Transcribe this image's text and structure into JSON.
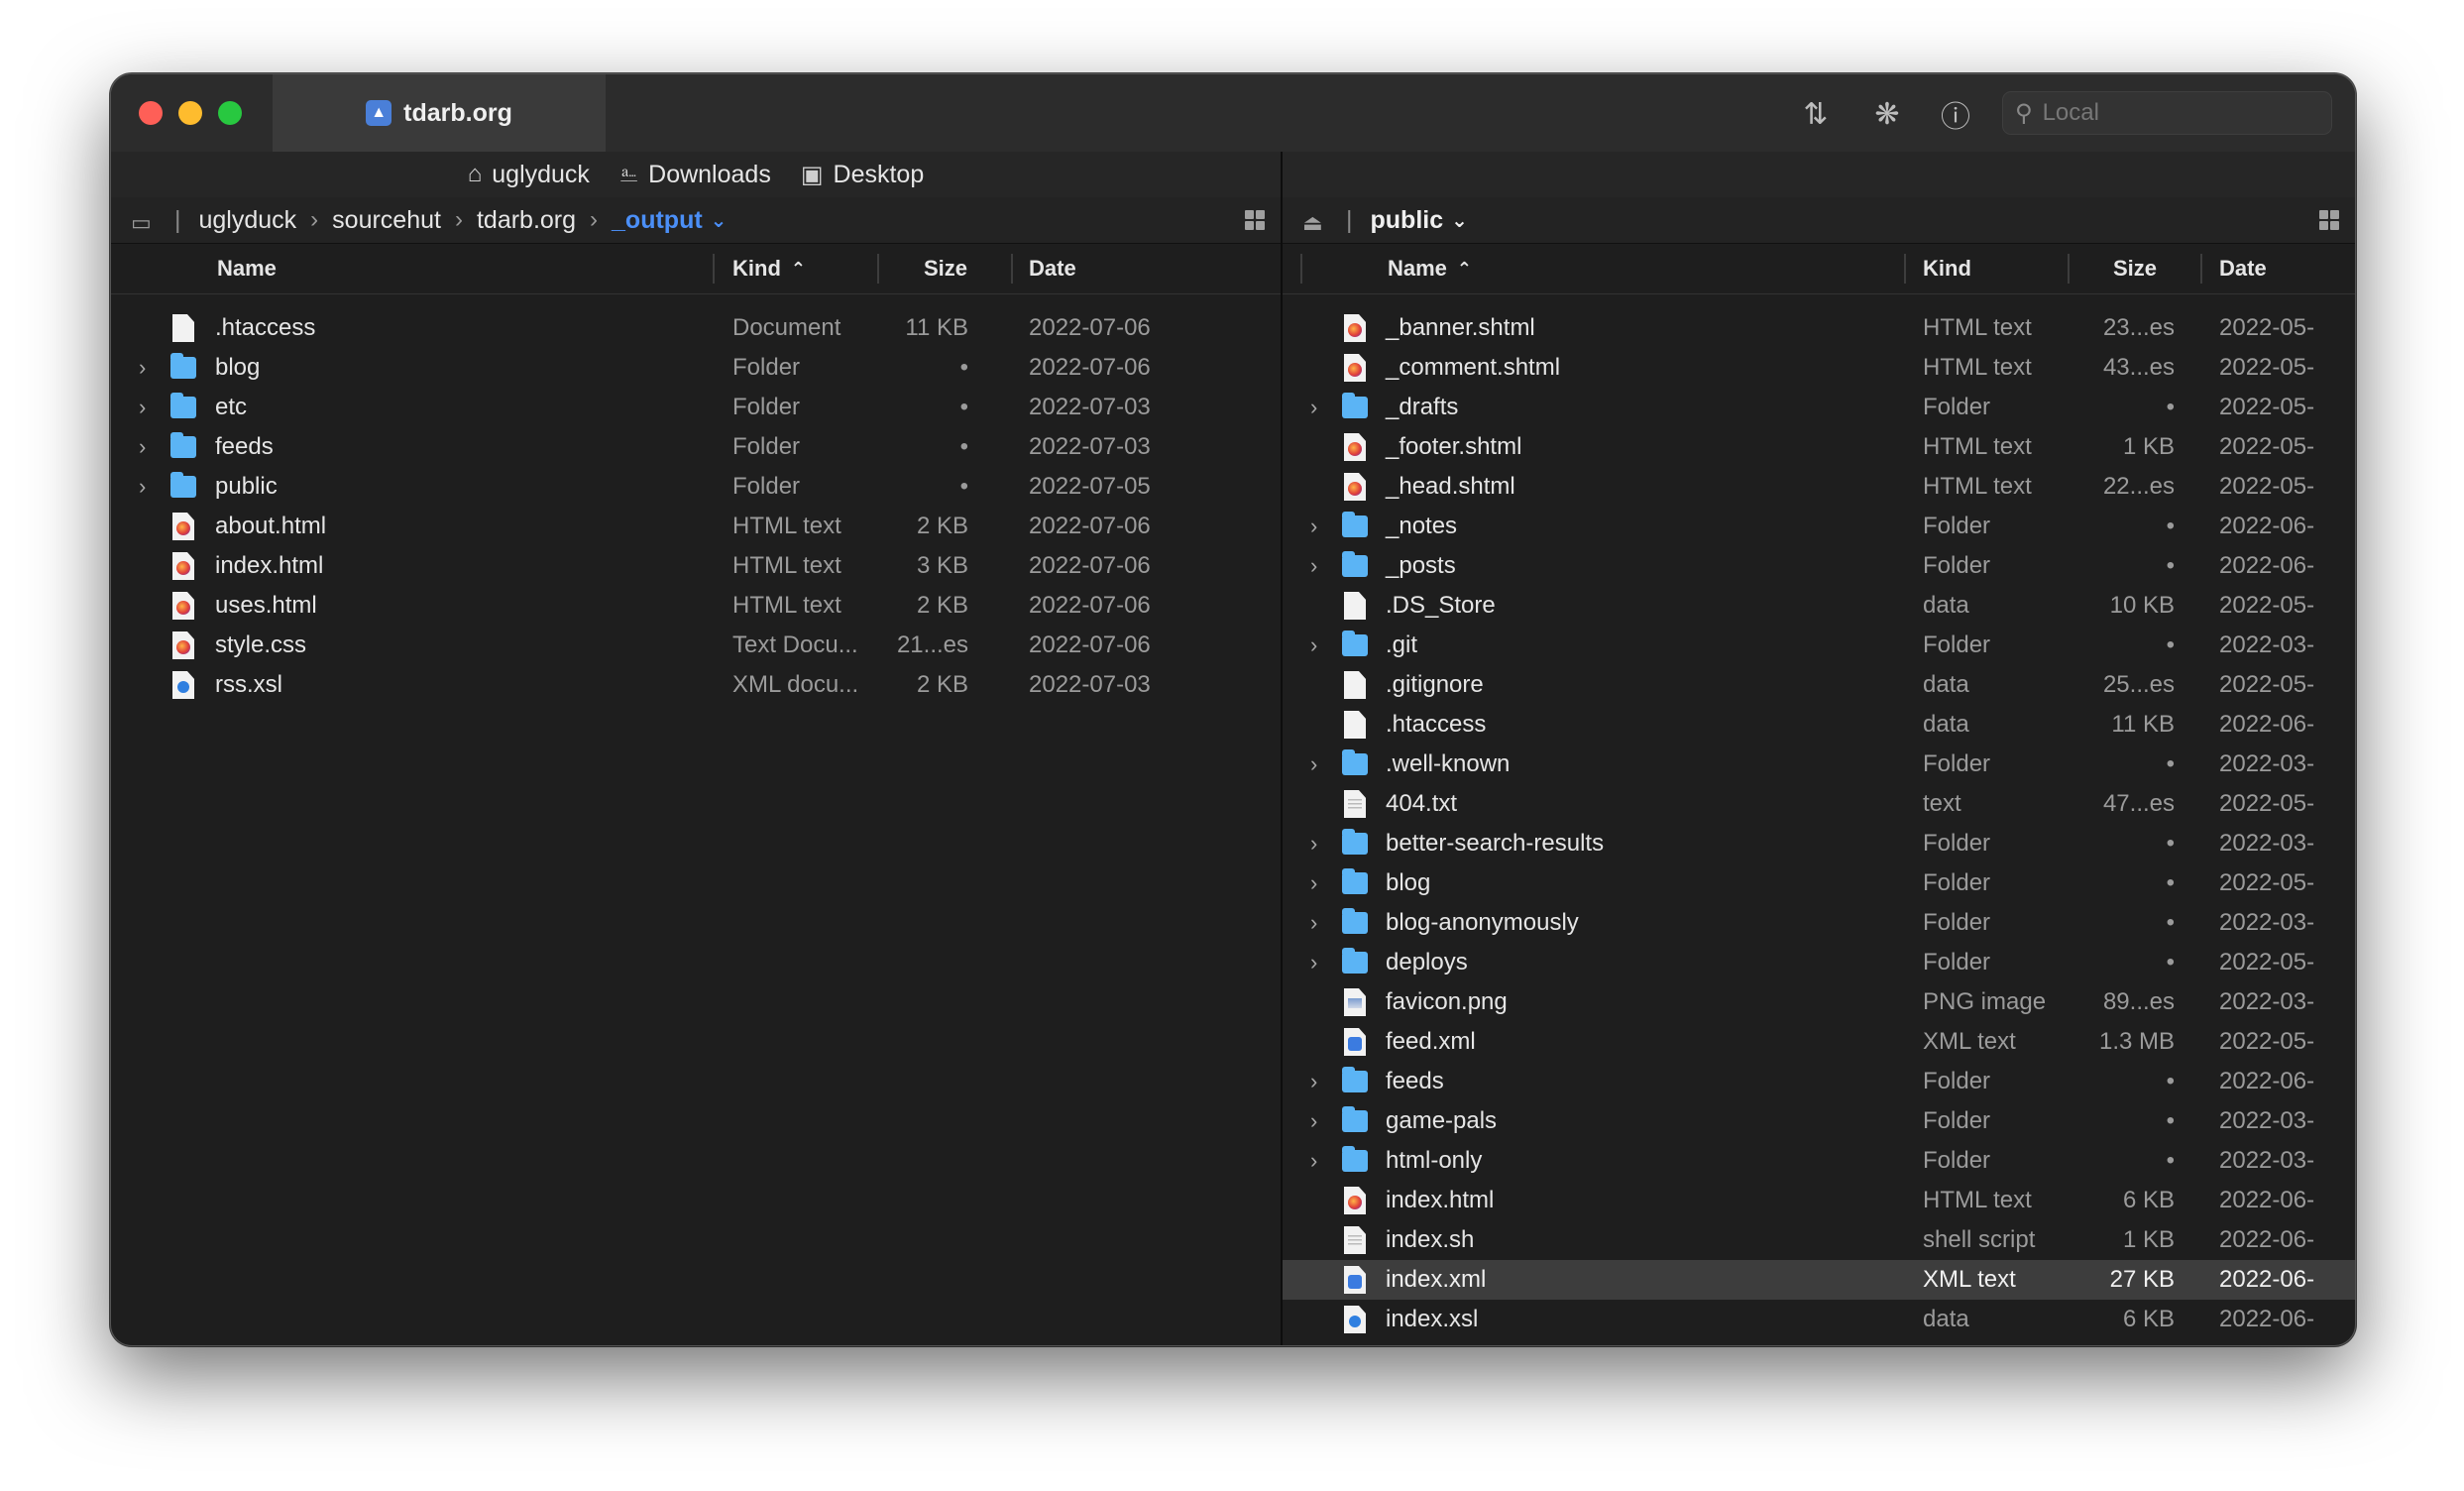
{
  "window": {
    "tab_title": "tdarb.org",
    "search_placeholder": "Local",
    "toolbar_icons": [
      "transfer-icon",
      "activity-icon",
      "info-icon"
    ]
  },
  "favorites": [
    {
      "label": "uglyduck",
      "icon": "home-icon"
    },
    {
      "label": "Downloads",
      "icon": "download-icon"
    },
    {
      "label": "Desktop",
      "icon": "desktop-icon"
    }
  ],
  "left": {
    "path": [
      "uglyduck",
      "sourcehut",
      "tdarb.org"
    ],
    "current": "_output",
    "columns": {
      "name": "Name",
      "kind": "Kind",
      "size": "Size",
      "date": "Date"
    },
    "sort_column": "Kind",
    "rows": [
      {
        "name": ".htaccess",
        "kind": "Document",
        "size": "11 KB",
        "date": "2022-07-06",
        "type": "doc",
        "expandable": false
      },
      {
        "name": "blog",
        "kind": "Folder",
        "size": "•",
        "date": "2022-07-06",
        "type": "folder",
        "expandable": true
      },
      {
        "name": "etc",
        "kind": "Folder",
        "size": "•",
        "date": "2022-07-03",
        "type": "folder",
        "expandable": true
      },
      {
        "name": "feeds",
        "kind": "Folder",
        "size": "•",
        "date": "2022-07-03",
        "type": "folder",
        "expandable": true
      },
      {
        "name": "public",
        "kind": "Folder",
        "size": "•",
        "date": "2022-07-05",
        "type": "folder",
        "expandable": true
      },
      {
        "name": "about.html",
        "kind": "HTML text",
        "size": "2 KB",
        "date": "2022-07-06",
        "type": "html",
        "expandable": false
      },
      {
        "name": "index.html",
        "kind": "HTML text",
        "size": "3 KB",
        "date": "2022-07-06",
        "type": "html",
        "expandable": false
      },
      {
        "name": "uses.html",
        "kind": "HTML text",
        "size": "2 KB",
        "date": "2022-07-06",
        "type": "html",
        "expandable": false
      },
      {
        "name": "style.css",
        "kind": "Text Docu...",
        "size": "21...es",
        "date": "2022-07-06",
        "type": "html",
        "expandable": false
      },
      {
        "name": "rss.xsl",
        "kind": "XML docu...",
        "size": "2 KB",
        "date": "2022-07-03",
        "type": "xsl",
        "expandable": false
      }
    ]
  },
  "right": {
    "current": "public",
    "columns": {
      "name": "Name",
      "kind": "Kind",
      "size": "Size",
      "date": "Date"
    },
    "sort_column": "Name",
    "rows": [
      {
        "name": "_banner.shtml",
        "kind": "HTML text",
        "size": "23...es",
        "date": "2022-05-",
        "type": "html",
        "expandable": false
      },
      {
        "name": "_comment.shtml",
        "kind": "HTML text",
        "size": "43...es",
        "date": "2022-05-",
        "type": "html",
        "expandable": false
      },
      {
        "name": "_drafts",
        "kind": "Folder",
        "size": "•",
        "date": "2022-05-",
        "type": "folder",
        "expandable": true
      },
      {
        "name": "_footer.shtml",
        "kind": "HTML text",
        "size": "1 KB",
        "date": "2022-05-",
        "type": "html",
        "expandable": false
      },
      {
        "name": "_head.shtml",
        "kind": "HTML text",
        "size": "22...es",
        "date": "2022-05-",
        "type": "html",
        "expandable": false
      },
      {
        "name": "_notes",
        "kind": "Folder",
        "size": "•",
        "date": "2022-06-",
        "type": "folder",
        "expandable": true
      },
      {
        "name": "_posts",
        "kind": "Folder",
        "size": "•",
        "date": "2022-06-",
        "type": "folder",
        "expandable": true
      },
      {
        "name": ".DS_Store",
        "kind": "data",
        "size": "10 KB",
        "date": "2022-05-",
        "type": "doc",
        "expandable": false
      },
      {
        "name": ".git",
        "kind": "Folder",
        "size": "•",
        "date": "2022-03-",
        "type": "folder",
        "expandable": true
      },
      {
        "name": ".gitignore",
        "kind": "data",
        "size": "25...es",
        "date": "2022-05-",
        "type": "doc",
        "expandable": false
      },
      {
        "name": ".htaccess",
        "kind": "data",
        "size": "11 KB",
        "date": "2022-06-",
        "type": "doc",
        "expandable": false
      },
      {
        "name": ".well-known",
        "kind": "Folder",
        "size": "•",
        "date": "2022-03-",
        "type": "folder",
        "expandable": true
      },
      {
        "name": "404.txt",
        "kind": "text",
        "size": "47...es",
        "date": "2022-05-",
        "type": "text",
        "expandable": false
      },
      {
        "name": "better-search-results",
        "kind": "Folder",
        "size": "•",
        "date": "2022-03-",
        "type": "folder",
        "expandable": true
      },
      {
        "name": "blog",
        "kind": "Folder",
        "size": "•",
        "date": "2022-05-",
        "type": "folder",
        "expandable": true
      },
      {
        "name": "blog-anonymously",
        "kind": "Folder",
        "size": "•",
        "date": "2022-03-",
        "type": "folder",
        "expandable": true
      },
      {
        "name": "deploys",
        "kind": "Folder",
        "size": "•",
        "date": "2022-05-",
        "type": "folder",
        "expandable": true
      },
      {
        "name": "favicon.png",
        "kind": "PNG image",
        "size": "89...es",
        "date": "2022-03-",
        "type": "png",
        "expandable": false
      },
      {
        "name": "feed.xml",
        "kind": "XML text",
        "size": "1.3 MB",
        "date": "2022-05-",
        "type": "xml",
        "expandable": false
      },
      {
        "name": "feeds",
        "kind": "Folder",
        "size": "•",
        "date": "2022-06-",
        "type": "folder",
        "expandable": true
      },
      {
        "name": "game-pals",
        "kind": "Folder",
        "size": "•",
        "date": "2022-03-",
        "type": "folder",
        "expandable": true
      },
      {
        "name": "html-only",
        "kind": "Folder",
        "size": "•",
        "date": "2022-03-",
        "type": "folder",
        "expandable": true
      },
      {
        "name": "index.html",
        "kind": "HTML text",
        "size": "6 KB",
        "date": "2022-06-",
        "type": "html",
        "expandable": false
      },
      {
        "name": "index.sh",
        "kind": "shell script",
        "size": "1 KB",
        "date": "2022-06-",
        "type": "text",
        "expandable": false
      },
      {
        "name": "index.xml",
        "kind": "XML text",
        "size": "27 KB",
        "date": "2022-06-",
        "type": "xml",
        "expandable": false,
        "selected": true
      },
      {
        "name": "index.xsl",
        "kind": "data",
        "size": "6 KB",
        "date": "2022-06-",
        "type": "xsl",
        "expandable": false
      }
    ]
  }
}
